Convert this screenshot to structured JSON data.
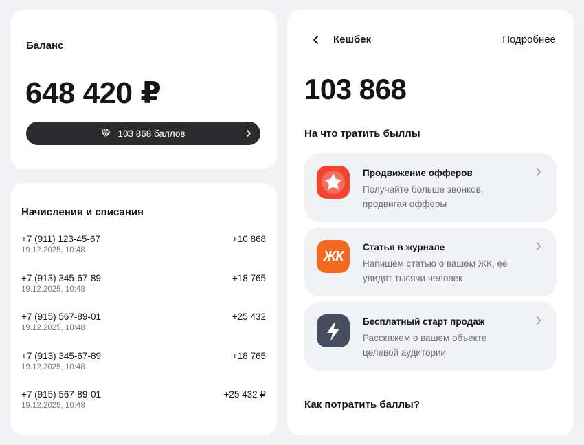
{
  "balance": {
    "title": "Баланс",
    "amount": "648 420 ₽",
    "points_label": "103 868 баллов"
  },
  "transactions": {
    "title": "Начисления и списания",
    "items": [
      {
        "phone": "+7 (911) 123-45-67",
        "date": "19.12.2025, 10:48",
        "amount": "+10 868"
      },
      {
        "phone": "+7 (913) 345-67-89",
        "date": "19.12.2025, 10:48",
        "amount": "+18 765"
      },
      {
        "phone": "+7 (915) 567-89-01",
        "date": "19.12.2025, 10:48",
        "amount": "+25 432"
      },
      {
        "phone": "+7 (913) 345-67-89",
        "date": "19.12.2025, 10:48",
        "amount": "+18 765"
      },
      {
        "phone": "+7 (915) 567-89-01",
        "date": "19.12.2025, 10:48",
        "amount": "+25 432 ₽"
      }
    ]
  },
  "cashback": {
    "title": "Кешбек",
    "more_label": "Подробнее",
    "amount": "103 868",
    "subtitle": "На что тратить быллы",
    "offers": [
      {
        "title": "Продвижение офферов",
        "description": "Получайте больше звонков, продвигая офферы",
        "icon": "star-icon",
        "color": "#f2452f"
      },
      {
        "title": "Статья в журнале",
        "description": "Напишем статью о вашем ЖК, её увидят тысячи человек",
        "icon_text": "ЖК",
        "color": "#f26a21"
      },
      {
        "title": "Бесплатный старт продаж",
        "description": "Расскажем о вашем объекте целевой аудитории",
        "icon": "lightning-icon",
        "color": "#454d5e"
      }
    ],
    "footer_question": "Как потратить баллы?"
  }
}
